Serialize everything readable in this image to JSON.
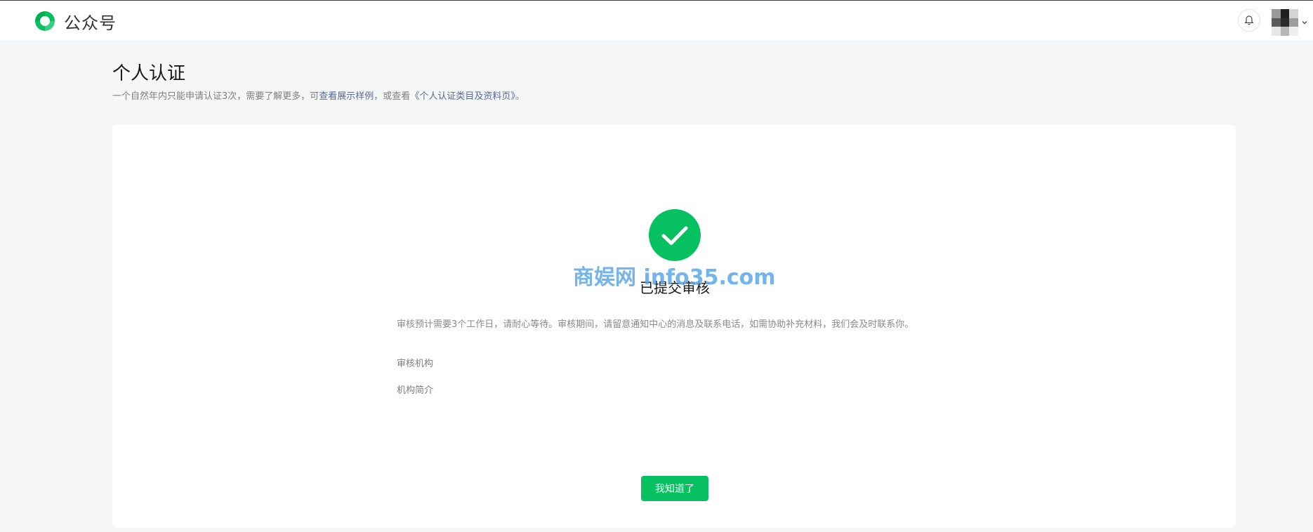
{
  "header": {
    "brand_name": "公众号",
    "logo_icon": "wechat-official-account-logo-icon",
    "notification_icon": "bell-icon",
    "avatar_icon": "user-avatar",
    "menu_icon": "chevron-down-icon"
  },
  "page": {
    "title": "个人认证",
    "description": {
      "prefix": "一个自然年内只能申请认证3次，需要了解更多，可",
      "link_examples": "查看展示样例",
      "middle": "，或查看",
      "link_categories": "《个人认证类目及资料页》",
      "suffix": "。"
    }
  },
  "status": {
    "icon": "check-circle-icon",
    "title": "已提交审核",
    "watermark": "商娱网 info35.com",
    "description": "审核预计需要3个工作日，请耐心等待。审核期间，请留意通知中心的消息及联系电话，如需协助补充材料，我们会及时联系你。",
    "fields": [
      {
        "label": "审核机构"
      },
      {
        "label": "机构简介"
      }
    ],
    "confirm_button": "我知道了"
  },
  "colors": {
    "accent": "#07c160",
    "link": "#576b95",
    "page_background": "#f5f6f7",
    "card_background": "#ffffff"
  }
}
